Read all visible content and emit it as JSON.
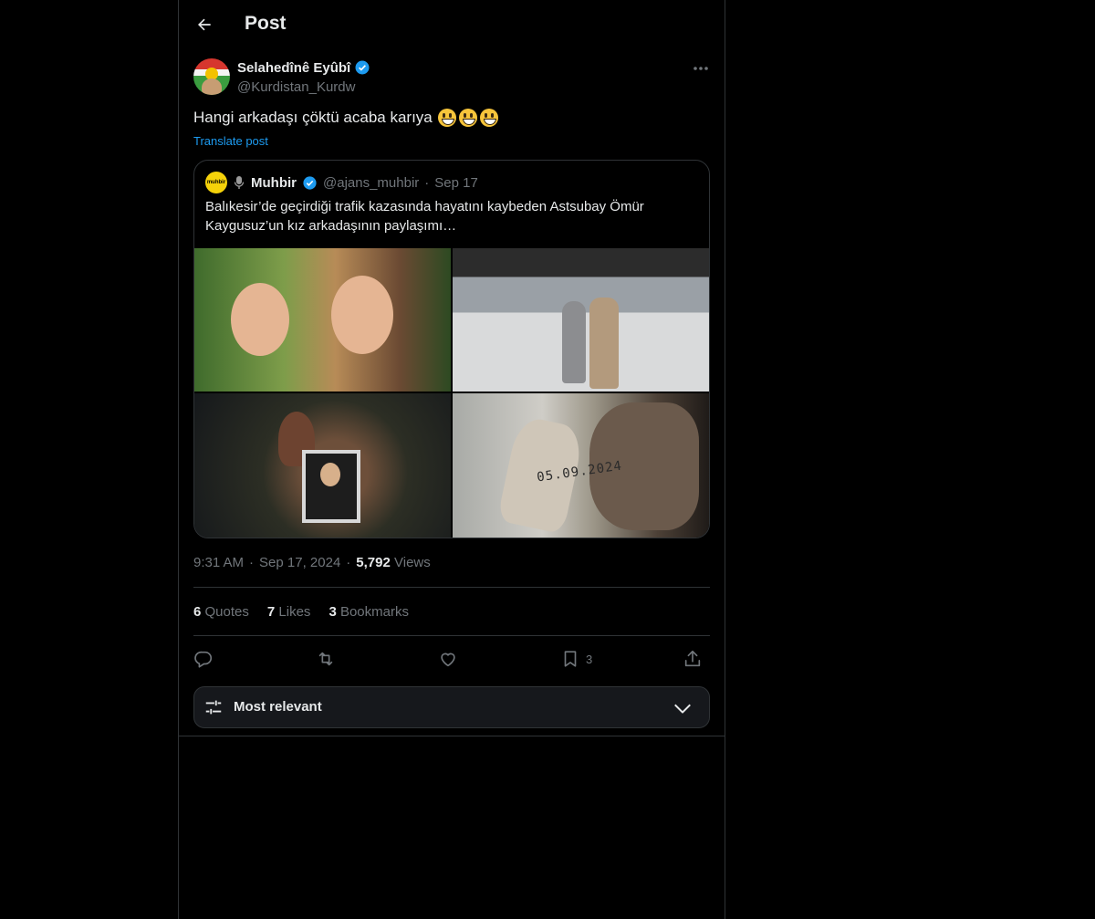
{
  "header": {
    "title": "Post"
  },
  "post": {
    "author_name": "Selahedînê Eyûbî",
    "handle": "@Kurdistan_Kurdw",
    "text": "Hangi arkadaşı çöktü acaba karıya",
    "emoji": "😃",
    "translate_label": "Translate post",
    "time": "9:31 AM",
    "date": "Sep 17, 2024",
    "views_count": "5,792",
    "views_label": "Views",
    "separator": "·"
  },
  "quote": {
    "avatar_text": "muhbir",
    "name": "Muhbir",
    "handle": "@ajans_muhbir",
    "date": "Sep 17",
    "text": "Balıkesir’de geçirdiği trafik kazasında hayatını kaybeden Astsubay Ömür Kaygusuz’un kız arkadaşının paylaşımı…",
    "sock_text": "05.09.2024"
  },
  "stats": {
    "quotes_count": "6",
    "quotes_label": "Quotes",
    "likes_count": "7",
    "likes_label": "Likes",
    "bookmarks_count": "3",
    "bookmarks_label": "Bookmarks"
  },
  "actions": {
    "bookmark_count": "3"
  },
  "sort": {
    "label": "Most relevant"
  },
  "colors": {
    "accent": "#1d9bf0",
    "muted": "#71767b",
    "text": "#e7e9ea",
    "border": "#2f3336",
    "background": "#000000"
  },
  "icons": [
    "back-arrow-icon",
    "verified-badge-icon",
    "more-icon",
    "microphone-icon",
    "reply-icon",
    "repost-icon",
    "like-icon",
    "bookmark-icon",
    "share-icon",
    "sliders-icon",
    "chevron-down-icon"
  ]
}
